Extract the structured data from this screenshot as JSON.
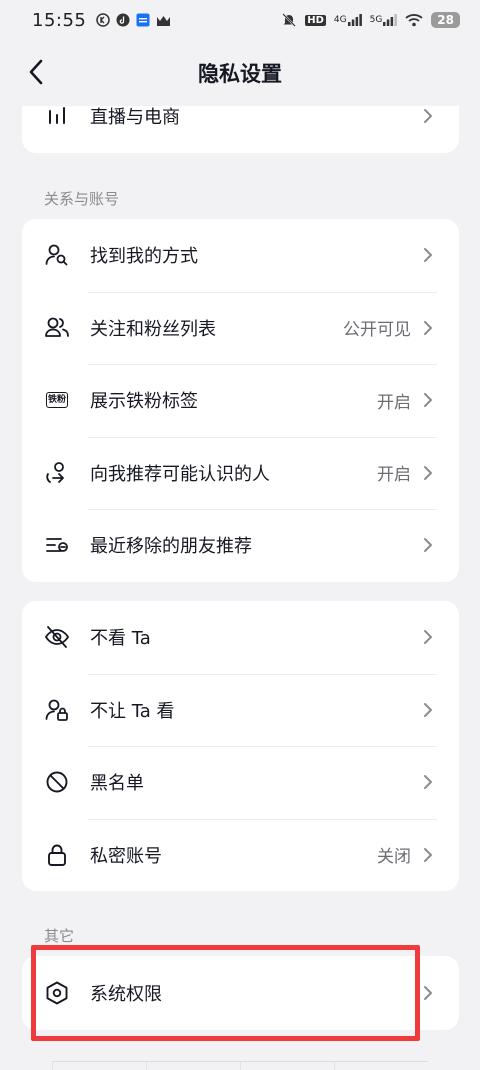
{
  "status_bar": {
    "time": "15:55",
    "network_left": "HD",
    "net1": "4G",
    "net2": "5G",
    "battery": "28"
  },
  "nav": {
    "title": "隐私设置"
  },
  "top_card": {
    "item": {
      "label": "直播与电商",
      "icon": "bar-chart-icon"
    }
  },
  "section_relations": {
    "title": "关系与账号",
    "items": [
      {
        "label": "找到我的方式",
        "value": "",
        "icon": "person-search-icon"
      },
      {
        "label": "关注和粉丝列表",
        "value": "公开可见",
        "icon": "people-icon"
      },
      {
        "label": "展示铁粉标签",
        "value": "开启",
        "icon": "tiefen-badge-icon",
        "badge": "铁粉"
      },
      {
        "label": "向我推荐可能认识的人",
        "value": "开启",
        "icon": "recommend-person-icon"
      },
      {
        "label": "最近移除的朋友推荐",
        "value": "",
        "icon": "removed-list-icon"
      }
    ]
  },
  "section_block": {
    "items": [
      {
        "label": "不看 Ta",
        "value": "",
        "icon": "eye-off-icon"
      },
      {
        "label": "不让 Ta 看",
        "value": "",
        "icon": "person-lock-icon"
      },
      {
        "label": "黑名单",
        "value": "",
        "icon": "blocked-icon"
      },
      {
        "label": "私密账号",
        "value": "关闭",
        "icon": "lock-icon"
      }
    ]
  },
  "section_other": {
    "title": "其它",
    "items": [
      {
        "label": "系统权限",
        "value": "",
        "icon": "hexagon-settings-icon"
      }
    ]
  },
  "colors": {
    "background": "#f2f2f4",
    "card": "#ffffff",
    "highlight": "#ef3b3b"
  }
}
